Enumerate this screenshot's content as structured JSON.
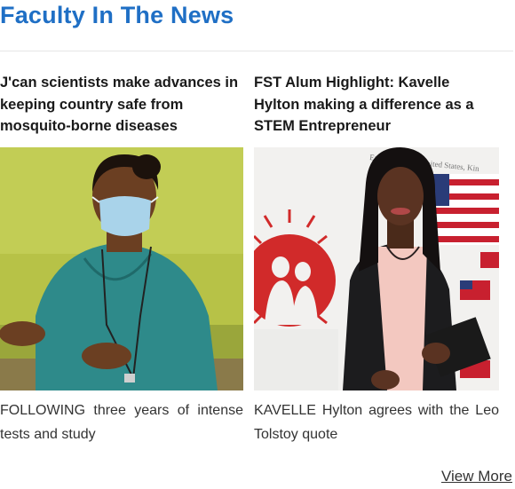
{
  "section": {
    "title": "Faculty In The News"
  },
  "articles": [
    {
      "title": "J'can scientists make advances in keeping country safe from mosquito-borne diseases",
      "excerpt": "FOLLOWING three years of intense tests and study",
      "image_desc": "woman-in-mask-photo"
    },
    {
      "title": "FST Alum Highlight: Kavelle Hylton making a difference as a STEM Entrepreneur",
      "excerpt": "KAVELLE Hylton agrees with the Leo Tolstoy quote",
      "image_desc": "woman-at-embassy-photo",
      "image_banner_text": "Embassy of the United States, Kin"
    }
  ],
  "footer": {
    "view_more_label": "View More"
  },
  "colors": {
    "title_blue": "#1f6fc5"
  }
}
